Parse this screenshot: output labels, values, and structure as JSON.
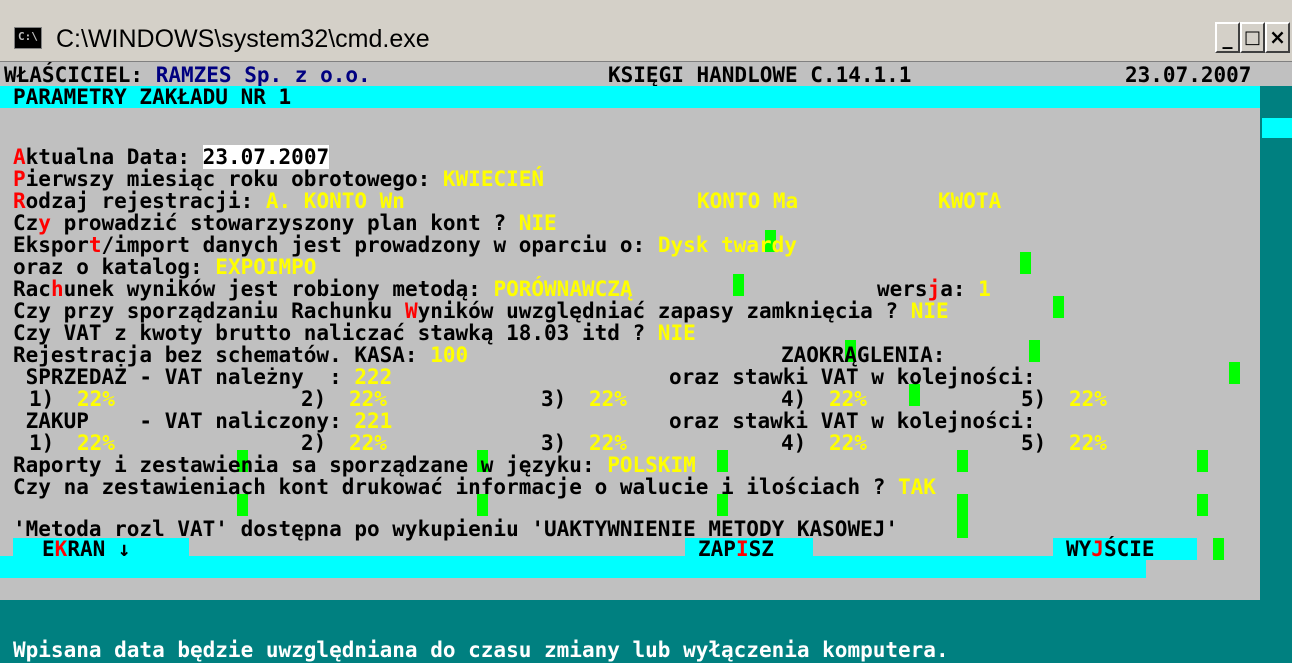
{
  "window": {
    "title": "C:\\WINDOWS\\system32\\cmd.exe",
    "icon": "console-icon",
    "icon_label": "C:\\",
    "buttons": [
      "_",
      "□",
      "×"
    ]
  },
  "header": {
    "owner_label": "WŁAŚCICIEL: ",
    "owner_name": "RAMZES Sp. z o.o.",
    "app": "KSIĘGI HANDLOWE C.14.1.1",
    "date": "23.07.2007"
  },
  "section_title": "PARAMETRY ZAKŁADU NR 1",
  "form": {
    "date_hot": "A",
    "date_label": "ktualna Data: ",
    "date_value": "23.07.2007",
    "first_month_hot": "P",
    "first_month_label": "ierwszy miesiąc roku obrotowego: ",
    "first_month_value": "KWIECIEŃ",
    "reg_hot": "R",
    "reg_label": "odzaj rejestracji: ",
    "reg_a": "A. KONTO Wn",
    "reg_b": "KONTO Ma",
    "reg_c": "KWOTA",
    "plan_pre": "Cz",
    "plan_hot": "y",
    "plan_label": " prowadzić stowarzyszony plan kont ? ",
    "plan_value": "NIE",
    "export_pre": "Ekspor",
    "export_hot": "t",
    "export_label": "/import danych jest prowadzony w oparciu o: ",
    "export_value": "Dysk twardy",
    "catalog_label": "oraz o katalog: ",
    "catalog_value": "EXPOIMPO",
    "rach_pre": "Rac",
    "rach_hot": "h",
    "rach_label": "unek wyników jest robiony metodą: ",
    "rach_value": "PORÓWNAWCZĄ",
    "version_pre": "wers",
    "version_hot": "j",
    "version_label": "a: ",
    "version_value": "1",
    "stock_pre": "Czy przy sporządzaniu Rachunku ",
    "stock_hot": "W",
    "stock_label": "yników uwzględniać zapasy zamknięcia ? ",
    "stock_value": "NIE",
    "vat_gross_label": "Czy VAT z kwoty brutto naliczać stawką 18.03 itd ? ",
    "vat_gross_value": "NIE",
    "reg_noschema_label": "Rejestracja bez schematów. KASA: ",
    "kasa_value": "100",
    "rounding_label": "ZAOKRĄGLENIA:",
    "sales_label": " SPRZEDAŻ - VAT należny  : ",
    "sales_account": "222",
    "rates_label": "oraz stawki VAT w kolejności:",
    "purchase_label": " ZAKUP    - VAT naliczony: ",
    "purchase_account": "221",
    "rate_nums": [
      "1)",
      "2)",
      "3)",
      "4)",
      "5)"
    ],
    "sales_rates": [
      "22%",
      "22%",
      "22%",
      "22%",
      "22%"
    ],
    "purchase_rates": [
      "22%",
      "22%",
      "22%",
      "22%",
      "22%"
    ],
    "lang_label": "Raporty i zestawienia sa sporządzane w języku: ",
    "lang_value": "POLSKIM",
    "currency_label": "Czy na zestawieniach kont drukować informacje o walucie i ilościach ? ",
    "currency_value": "TAK"
  },
  "vat_notice": "'Metoda rozl VAT' dostępna po wykupieniu 'UAKTYWNIENIE METODY KASOWEJ'",
  "buttons": {
    "screen_pre": "E",
    "screen_hot": "K",
    "screen_post": "RAN ↓",
    "save_pre": "ZAP",
    "save_hot": "I",
    "save_post": "SZ",
    "exit_pre": "WY",
    "exit_hot": "J",
    "exit_post": "ŚCIE"
  },
  "status_message": "Wpisana data będzie uwzględniana do czasu zmiany lub wyłączenia komputera."
}
